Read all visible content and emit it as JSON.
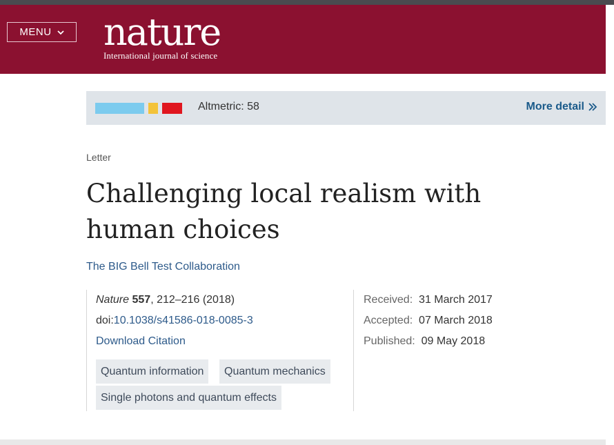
{
  "header": {
    "menu_label": "MENU",
    "logo_word": "nature",
    "logo_tagline": "International journal of science",
    "brand_color": "#8b1130"
  },
  "altmetric": {
    "label": "Altmetric: 58",
    "more_detail": "More detail",
    "donut_colors": [
      "#7ccbee",
      "#f3c33a",
      "#e0161f"
    ]
  },
  "article": {
    "type": "Letter",
    "title": "Challenging local realism with human choices",
    "authors": "The BIG Bell Test Collaboration",
    "journal": "Nature",
    "volume": "557",
    "pages": ", 212–216 (2018)",
    "doi_prefix": "doi:",
    "doi": "10.1038/s41586-018-0085-3",
    "download_citation": "Download Citation",
    "subjects": [
      "Quantum information",
      "Quantum mechanics",
      "Single photons and quantum effects"
    ],
    "dates": {
      "received_label": "Received:",
      "received": "31 March 2017",
      "accepted_label": "Accepted:",
      "accepted": "07 March 2018",
      "published_label": "Published:",
      "published": "09 May 2018"
    }
  }
}
